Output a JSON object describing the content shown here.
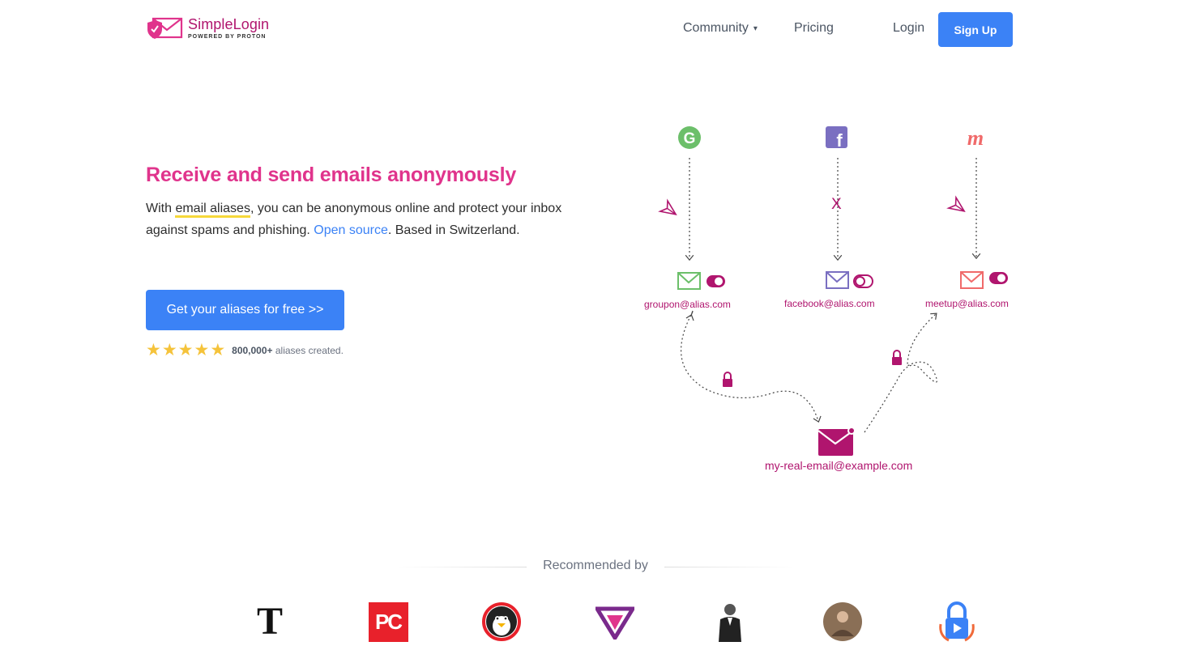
{
  "nav": {
    "logo_name": "SimpleLogin",
    "logo_sub": "POWERED BY PROTON",
    "community": "Community",
    "pricing": "Pricing",
    "login": "Login",
    "signup": "Sign Up"
  },
  "hero": {
    "title": "Receive and send emails anonymously",
    "text_pre": "With ",
    "text_aliases": "email aliases",
    "text_mid": ", you can be anonymous online and protect your inbox against spams and phishing. ",
    "text_open_source": "Open source",
    "text_post": ". Based in Switzerland.",
    "cta": "Get your aliases for free >>",
    "rating_count": "800,000+",
    "rating_suffix": "aliases created."
  },
  "diagram": {
    "aliases": [
      {
        "email": "groupon@alias.com",
        "service_icon": "google-icon",
        "toggle": "on"
      },
      {
        "email": "facebook@alias.com",
        "service_icon": "facebook-icon",
        "toggle": "off"
      },
      {
        "email": "meetup@alias.com",
        "service_icon": "meetup-icon",
        "toggle": "on"
      }
    ],
    "blocked_mark": "X",
    "real_email": "my-real-email@example.com"
  },
  "recommended": {
    "label": "Recommended by",
    "logos": [
      "nytimes-logo",
      "pcmag-logo",
      "linux-penguin-logo",
      "privacy-v-logo",
      "suit-man-logo",
      "avatar-photo-logo",
      "vpn-lock-logo"
    ]
  },
  "colors": {
    "brand_magenta": "#b0156e",
    "title_pink": "#e0348c",
    "button_blue": "#3b82f6",
    "star_yellow": "#f5c33b"
  }
}
